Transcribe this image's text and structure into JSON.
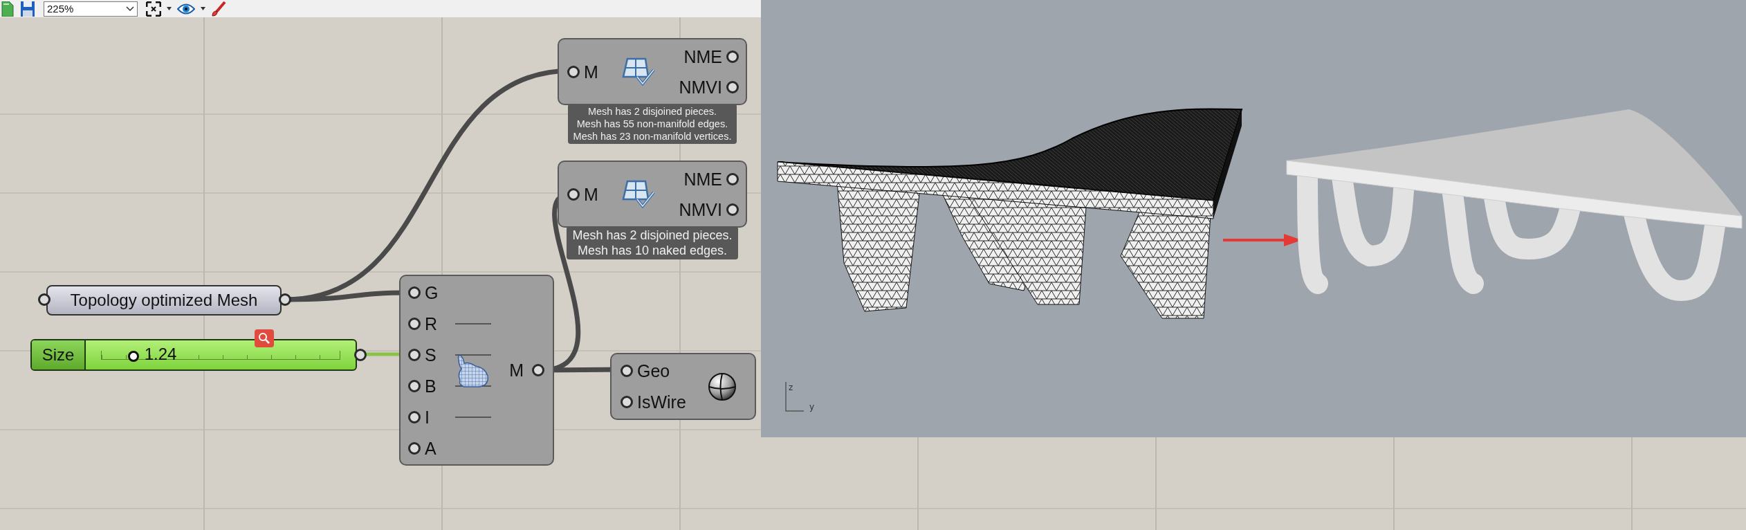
{
  "toolbar": {
    "zoom": "225%"
  },
  "mesh_checks": [
    {
      "input": "M",
      "outputs": [
        "NME",
        "NMVI"
      ],
      "messages": [
        "Mesh has 2 disjoined pieces.",
        "Mesh has 55 non-manifold edges.",
        "Mesh has 23 non-manifold vertices."
      ]
    },
    {
      "input": "M",
      "outputs": [
        "NME",
        "NMVI"
      ],
      "messages": [
        "Mesh has 2 disjoined pieces.",
        "Mesh has 10 naked edges."
      ]
    }
  ],
  "panel": {
    "text": "Topology optimized Mesh"
  },
  "slider": {
    "label": "Size",
    "value": "1.24",
    "level": 0.13
  },
  "remesh": {
    "inputs": [
      {
        "label": "G",
        "default_line": false
      },
      {
        "label": "R",
        "default_line": true
      },
      {
        "label": "S",
        "default_line": true
      },
      {
        "label": "B",
        "default_line": true
      },
      {
        "label": "I",
        "default_line": true
      },
      {
        "label": "A",
        "default_line": false
      }
    ],
    "output": "M"
  },
  "display": {
    "inputs": [
      "Geo",
      "IsWire"
    ]
  },
  "viewport": {
    "axis_labels": [
      "z",
      "y"
    ]
  }
}
